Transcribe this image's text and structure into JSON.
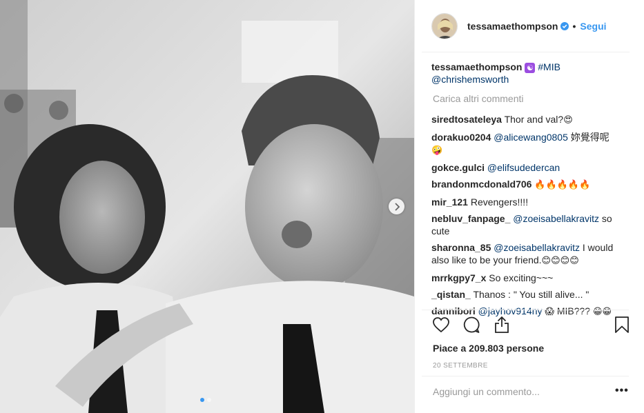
{
  "post": {
    "username": "tessamaethompson",
    "follow_label": "Segui",
    "bullet": "•",
    "caption": {
      "user": "tessamaethompson",
      "emoji": "☯",
      "hashtag": "#MIB",
      "mention": "@chrishemsworth"
    },
    "load_more": "Carica altri commenti",
    "comments": [
      {
        "user": "siredtosateleya",
        "text": "Thor and val?",
        "emoji": "😍"
      },
      {
        "user": "dorakuo0204",
        "mention": "@alicewang0805",
        "text": "妳覺得呢",
        "emoji": "🤪"
      },
      {
        "user": "gokce.gulci",
        "mention": "@elifsudedercan"
      },
      {
        "user": "brandonmcdonald706",
        "emoji": "🔥🔥🔥🔥🔥"
      },
      {
        "user": "mir_121",
        "text": "Revengers!!!!"
      },
      {
        "user": "nebluv_fanpage_",
        "mention": "@zoeisabellakravitz",
        "text": "so cute"
      },
      {
        "user": "sharonna_85",
        "mention": "@zoeisabellakravitz",
        "text": "I would also like to be your friend.",
        "emoji": "😊😊😊😊"
      },
      {
        "user": "mrrkgpy7_x",
        "text": "So exciting~~~"
      },
      {
        "user": "_qistan_",
        "text": "Thanos : \" You still alive... \""
      },
      {
        "user": "dannibori",
        "mention": "@jayhov914ny",
        "emoji": "😱",
        "text": "MIB???",
        "emoji2": "😁😁"
      }
    ],
    "likes": "Piace a 209.803 persone",
    "date": "20 SETTEMBRE",
    "add_comment_placeholder": "Aggiungi un commento...",
    "more_options": "•••"
  },
  "carousel": {
    "total": 2,
    "current": 1
  },
  "icons": {
    "verified": "verified-badge-icon",
    "like": "heart-icon",
    "comment": "comment-bubble-icon",
    "share": "share-icon",
    "save": "bookmark-icon",
    "next": "chevron-right-icon"
  },
  "colors": {
    "link": "#3897f0",
    "mention": "#003569",
    "muted": "#999999",
    "text": "#262626"
  }
}
